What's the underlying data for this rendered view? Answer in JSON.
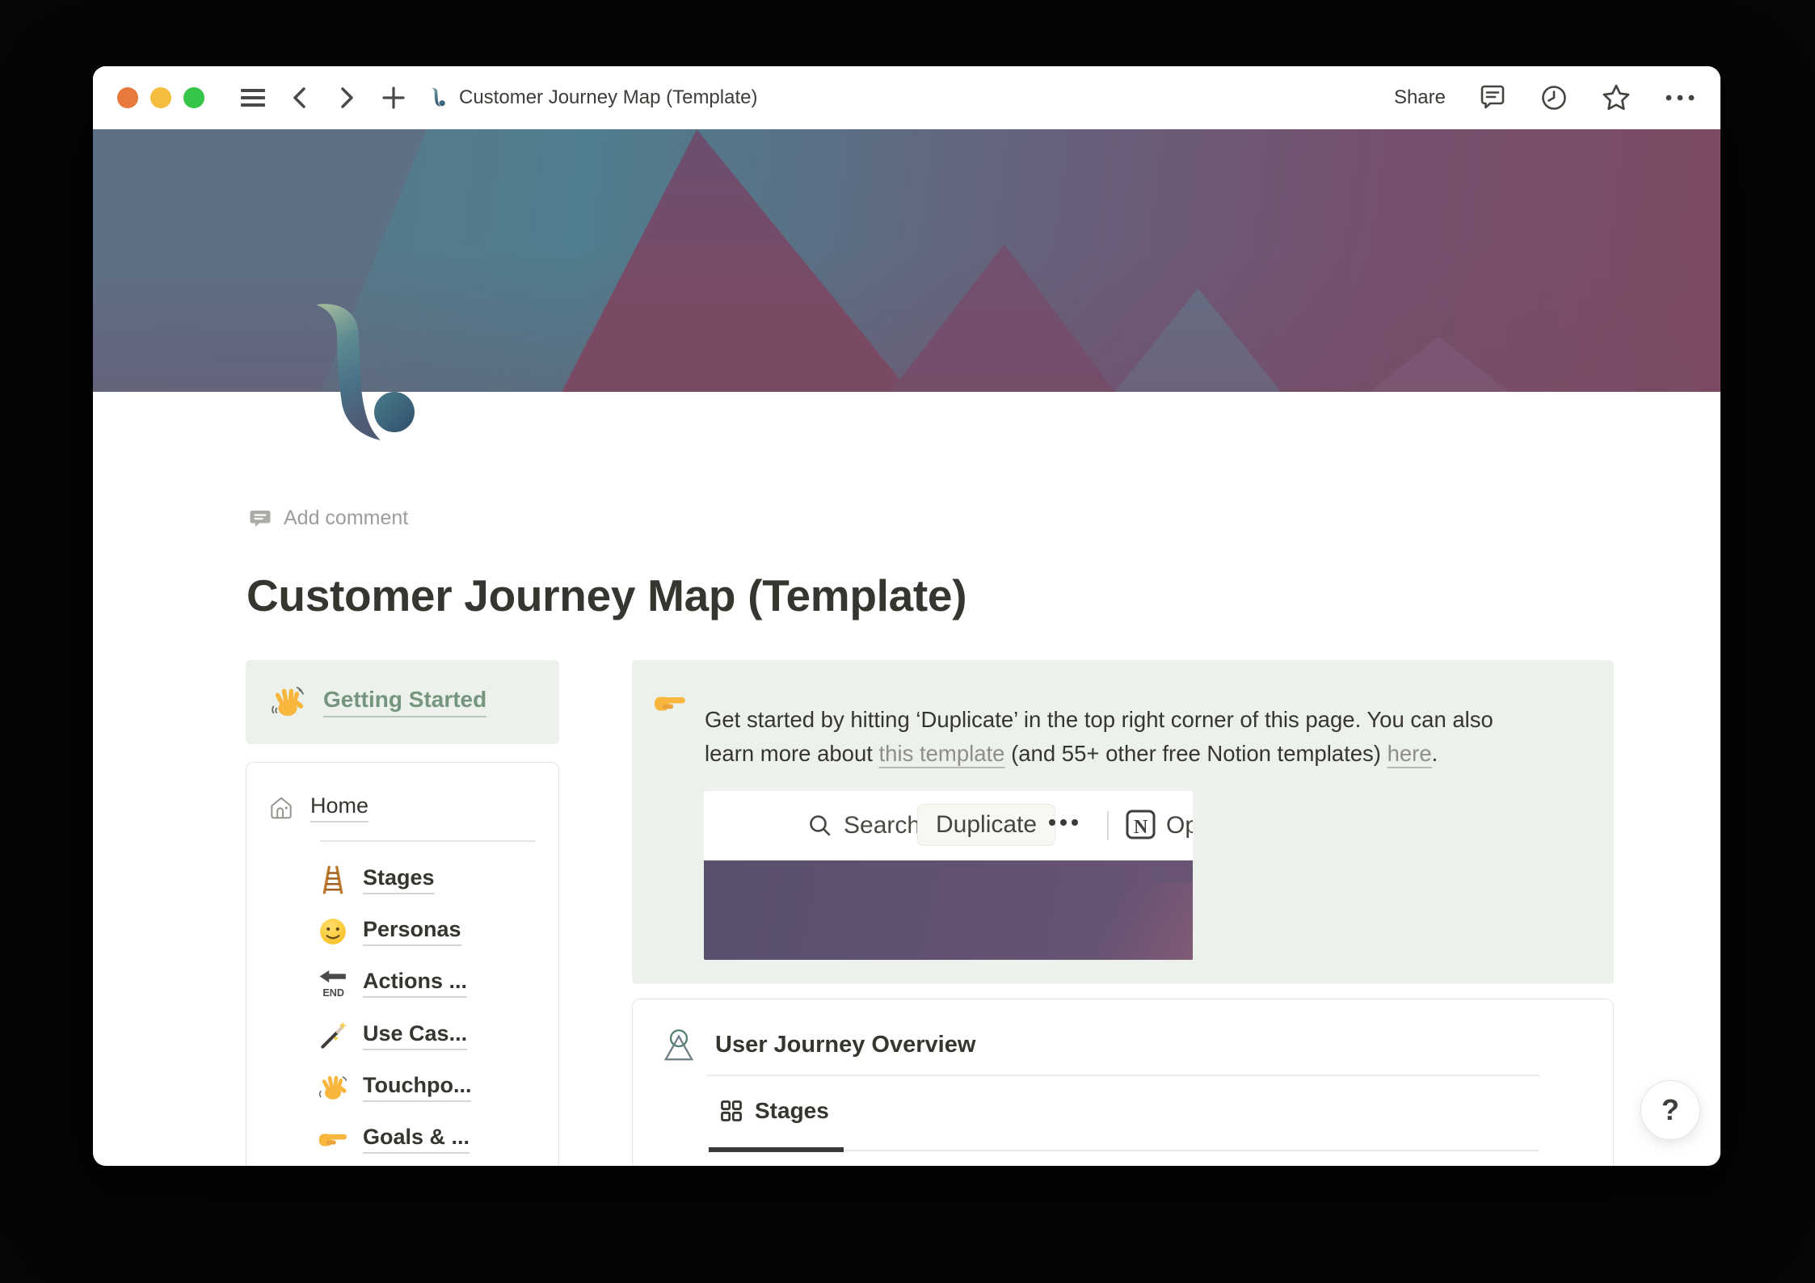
{
  "titlebar": {
    "title": "Customer Journey Map (Template)",
    "share_label": "Share"
  },
  "page": {
    "add_comment_label": "Add comment",
    "title": "Customer Journey Map (Template)",
    "getting_started_label": "Getting Started",
    "nav": {
      "home": {
        "label": "Home"
      },
      "end_arrow_text": "END",
      "items": [
        {
          "icon": "ladder-emoji",
          "label": "Stages"
        },
        {
          "icon": "smiley-emoji",
          "label": "Personas"
        },
        {
          "icon": "end-arrow-emoji",
          "label": "Actions ..."
        },
        {
          "icon": "magic-wand-emoji",
          "label": "Use Cas..."
        },
        {
          "icon": "wave-emoji",
          "label": "Touchpo..."
        },
        {
          "icon": "point-right-emoji",
          "label": "Goals & ..."
        }
      ]
    },
    "callout": {
      "icon": "point-right-emoji",
      "text_part1": "Get started by hitting ‘Duplicate’ in the top right corner of this page. You can also learn more about ",
      "link1": "this template",
      "text_part2": " (and 55+ other free Notion templates) ",
      "link2": "here",
      "text_part3": "."
    },
    "screenshot": {
      "search_label": "Search",
      "duplicate_label": "Duplicate",
      "notion_letter": "N",
      "open_label": "Open in app"
    },
    "overview": {
      "title": "User Journey Overview",
      "tab_label": "Stages"
    },
    "help_label": "?"
  },
  "icons": [
    "hamburger-icon",
    "back-icon",
    "forward-icon",
    "plus-icon",
    "page-logo-icon",
    "comment-icon",
    "clock-icon",
    "star-icon",
    "ellipsis-icon",
    "speech-bubble-icon",
    "wave-emoji",
    "house-icon",
    "ladder-emoji",
    "smiley-emoji",
    "end-arrow-emoji",
    "magic-wand-emoji",
    "point-right-emoji",
    "search-icon",
    "notion-logo-icon",
    "user-journey-icon",
    "grid-icon",
    "help-icon"
  ],
  "colors": {
    "callout_bg": "#ecf1ec",
    "accent_green": "#76957f",
    "cover_teal": "#4f7e8e",
    "cover_maroon": "#7c4a64",
    "embedded_cover_purple": "#5f5170",
    "text": "#37352f",
    "traffic_close": "#e8793d",
    "traffic_min": "#f5bd3d",
    "traffic_max": "#35c448"
  }
}
